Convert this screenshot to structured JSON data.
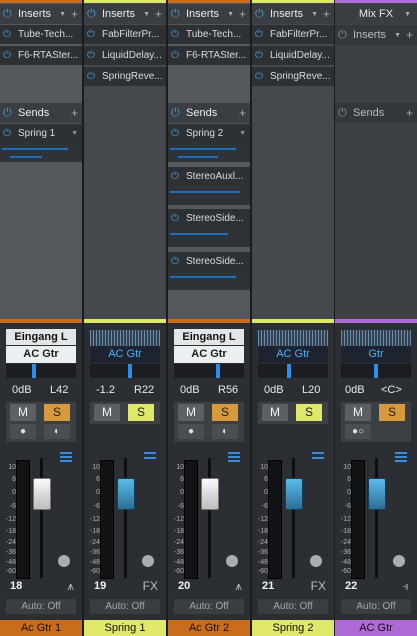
{
  "channels": [
    {
      "inserts_label": "Inserts",
      "inserts": [
        "Tube-Tech...",
        "F6-RTASter..."
      ],
      "sends_label": "Sends",
      "sends": [
        "Spring 1"
      ],
      "input": "Eingang L",
      "name_box": "AC Gtr",
      "gain": "0dB",
      "pan": "L42",
      "mute_label": "M",
      "solo_label": "S",
      "scale": [
        "10",
        "6",
        "0",
        "-6",
        "-12",
        "-18",
        "-24",
        "-36",
        "-48",
        "-60"
      ],
      "number": "18",
      "auto": "Auto: Off",
      "name": "Ac Gtr 1",
      "color": "#c96c1c"
    },
    {
      "inserts_label": "Inserts",
      "inserts": [
        "FabFilterPr...",
        "LiquidDelay...",
        "SpringReve..."
      ],
      "sends_label": "",
      "sends": [],
      "input": "",
      "name_box": "AC Gtr",
      "gain": "-1.2",
      "pan": "R22",
      "mute_label": "M",
      "solo_label": "S",
      "scale": [
        "10",
        "6",
        "0",
        "-6",
        "-12",
        "-18",
        "-24",
        "-36",
        "-48",
        "-60"
      ],
      "number": "19",
      "fx_icon": "FX",
      "auto": "Auto: Off",
      "name": "Spring 1",
      "color": "#dfe86a"
    },
    {
      "inserts_label": "Inserts",
      "inserts": [
        "Tube-Tech...",
        "F6-RTASter..."
      ],
      "sends_label": "Sends",
      "sends": [
        "Spring 2",
        "StereoAuxl...",
        "StereoSide...",
        "StereoSide..."
      ],
      "input": "Eingang L",
      "name_box": "AC Gtr",
      "gain": "0dB",
      "pan": "R56",
      "mute_label": "M",
      "solo_label": "S",
      "scale": [
        "10",
        "6",
        "0",
        "-6",
        "-12",
        "-18",
        "-24",
        "-36",
        "-48",
        "-60"
      ],
      "number": "20",
      "auto": "Auto: Off",
      "name": "Ac Gtr 2",
      "color": "#c96c1c"
    },
    {
      "inserts_label": "Inserts",
      "inserts": [
        "FabFilterPr...",
        "LiquidDelay...",
        "SpringReve..."
      ],
      "sends_label": "",
      "sends": [],
      "input": "",
      "name_box": "AC Gtr",
      "gain": "0dB",
      "pan": "L20",
      "mute_label": "M",
      "solo_label": "S",
      "scale": [
        "10",
        "6",
        "0",
        "-6",
        "-12",
        "-18",
        "-24",
        "-36",
        "-48",
        "-60"
      ],
      "number": "21",
      "fx_icon": "FX",
      "auto": "Auto: Off",
      "name": "Spring 2",
      "color": "#dfe86a"
    },
    {
      "mixfx_label": "Mix FX",
      "inserts_label": "Inserts",
      "inserts": [],
      "sends_label": "Sends",
      "sends": [],
      "input": "",
      "name_box": "Gtr",
      "gain": "0dB",
      "pan": "<C>",
      "mute_label": "M",
      "solo_label": "S",
      "scale": [
        "10",
        "6",
        "0",
        "-6",
        "-12",
        "-18",
        "-24",
        "-36",
        "-48",
        "-60"
      ],
      "number": "22",
      "auto": "Auto: Off",
      "name": "AC Gtr",
      "color": "#b06ad8"
    }
  ],
  "colors": {
    "accent_blue": "#2b8ff0",
    "solo_orange": "#d69a3c",
    "solo_yellow": "#dfe86a"
  }
}
